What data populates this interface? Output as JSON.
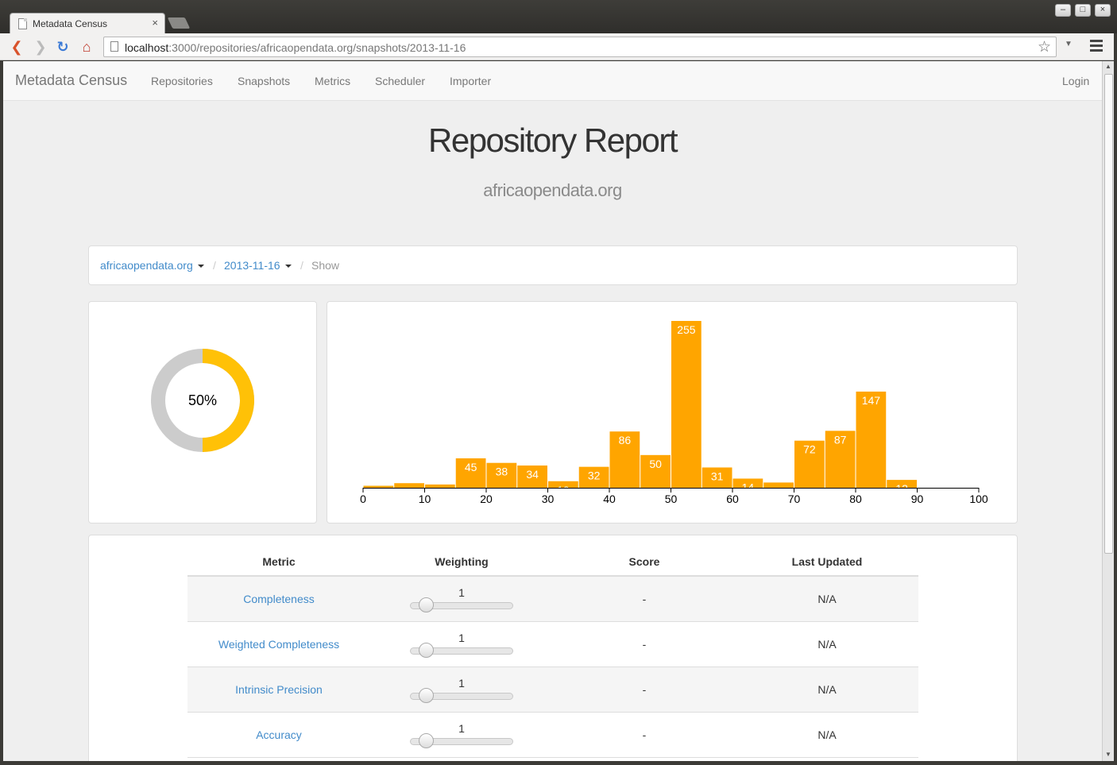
{
  "browser": {
    "tab_title": "Metadata Census",
    "tab_close": "×",
    "url_host": "localhost",
    "url_path": ":3000/repositories/africaopendata.org/snapshots/2013-11-16",
    "win_minimize": "–",
    "win_maximize": "□",
    "win_close": "×"
  },
  "navbar": {
    "brand": "Metadata Census",
    "links": [
      "Repositories",
      "Snapshots",
      "Metrics",
      "Scheduler",
      "Importer"
    ],
    "login": "Login"
  },
  "header": {
    "title": "Repository Report",
    "subtitle": "africaopendata.org"
  },
  "breadcrumb": {
    "repository": "africaopendata.org",
    "snapshot": "2013-11-16",
    "separator": "/",
    "current": "Show"
  },
  "donut": {
    "label": "50%",
    "value": 0.5,
    "fill_color": "#ffc107",
    "track_color": "#cccccc"
  },
  "chart_data": {
    "type": "bar",
    "title": "",
    "xlabel": "",
    "ylabel": "",
    "bar_color": "#ffa500",
    "xlim": [
      0,
      100
    ],
    "xticks": [
      0,
      10,
      20,
      30,
      40,
      50,
      60,
      70,
      80,
      90,
      100
    ],
    "bin_width": 5,
    "bins_start": [
      0,
      5,
      10,
      15,
      20,
      25,
      30,
      35,
      40,
      45,
      50,
      55,
      60,
      65,
      70,
      75,
      80,
      85
    ],
    "values": [
      3,
      7,
      5,
      45,
      38,
      34,
      10,
      32,
      86,
      50,
      255,
      31,
      14,
      8,
      72,
      87,
      147,
      12
    ]
  },
  "table": {
    "headers": [
      "Metric",
      "Weighting",
      "Score",
      "Last Updated"
    ],
    "rows": [
      {
        "metric": "Completeness",
        "weight": "1",
        "weight_value": 1,
        "score": "-",
        "updated": "N/A"
      },
      {
        "metric": "Weighted Completeness",
        "weight": "1",
        "weight_value": 1,
        "score": "-",
        "updated": "N/A"
      },
      {
        "metric": "Intrinsic Precision",
        "weight": "1",
        "weight_value": 1,
        "score": "-",
        "updated": "N/A"
      },
      {
        "metric": "Accuracy",
        "weight": "1",
        "weight_value": 1,
        "score": "-",
        "updated": "N/A"
      }
    ],
    "weight_range": [
      1,
      10
    ]
  }
}
